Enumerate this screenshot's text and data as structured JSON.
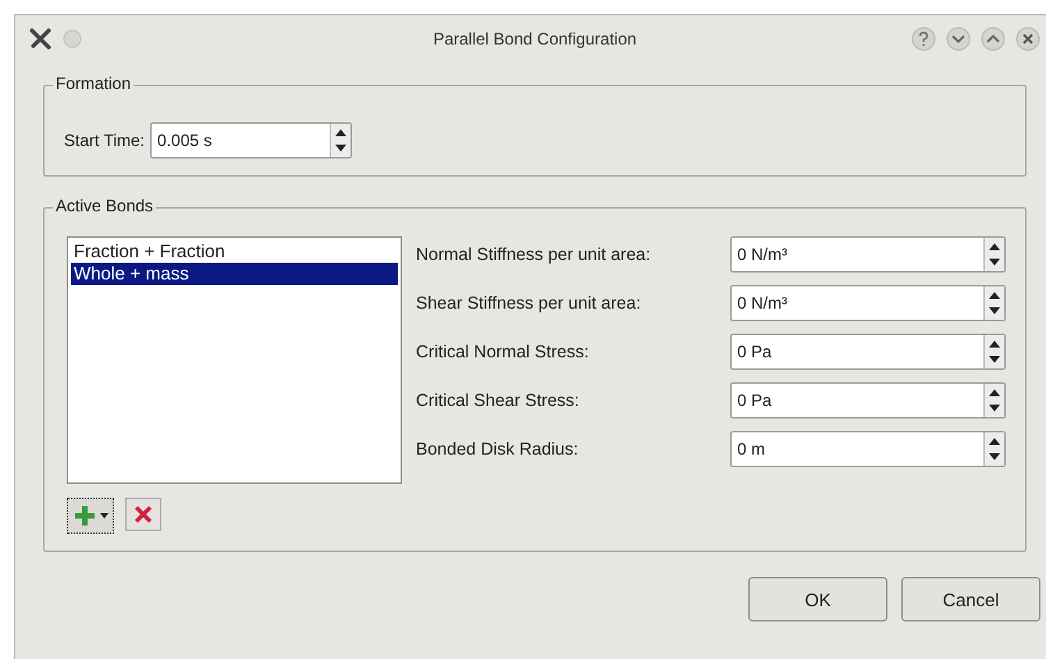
{
  "window": {
    "title": "Parallel Bond Configuration"
  },
  "formation": {
    "title": "Formation",
    "start_time": {
      "label": "Start Time:",
      "value": "0.005 s"
    }
  },
  "active_bonds": {
    "title": "Active Bonds",
    "list": [
      {
        "label": "Fraction + Fraction",
        "selected": false
      },
      {
        "label": "Whole + mass",
        "selected": true
      }
    ],
    "fields": [
      {
        "label": "Normal Stiffness per unit area:",
        "value": "0 N/m³"
      },
      {
        "label": "Shear Stiffness per unit area:",
        "value": "0 N/m³"
      },
      {
        "label": "Critical Normal Stress:",
        "value": "0 Pa"
      },
      {
        "label": "Critical Shear Stress:",
        "value": "0 Pa"
      },
      {
        "label": "Bonded Disk Radius:",
        "value": "0 m"
      }
    ]
  },
  "buttons": [
    "OK",
    "Cancel"
  ]
}
